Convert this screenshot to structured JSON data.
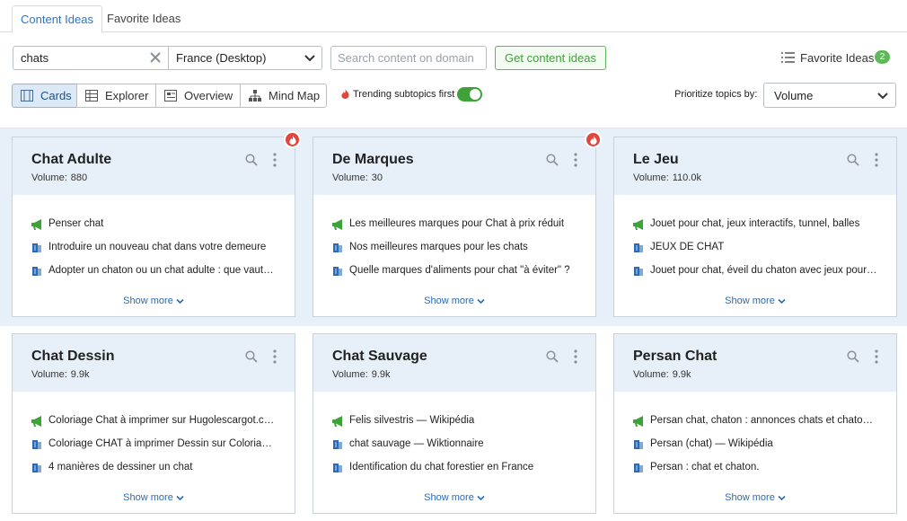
{
  "tabs": [
    {
      "label": "Content Ideas",
      "active": true
    },
    {
      "label": "Favorite Ideas",
      "active": false
    }
  ],
  "search": {
    "value": "chats"
  },
  "region": {
    "value": "France (Desktop)"
  },
  "domain_search": {
    "placeholder": "Search content on domain"
  },
  "get_button": {
    "label": "Get content ideas"
  },
  "favorite_ideas": {
    "label": "Favorite Ideas",
    "count": "2"
  },
  "views": [
    {
      "label": "Cards",
      "active": true,
      "icon": "cards-icon"
    },
    {
      "label": "Explorer",
      "active": false,
      "icon": "table-icon"
    },
    {
      "label": "Overview",
      "active": false,
      "icon": "overview-icon"
    },
    {
      "label": "Mind Map",
      "active": false,
      "icon": "mindmap-icon"
    }
  ],
  "trending": {
    "label": "Trending subtopics first",
    "enabled": true
  },
  "prioritize": {
    "label": "Prioritize topics by:",
    "value": "Volume"
  },
  "volume_label": "Volume:",
  "show_more_label": "Show more",
  "colors": {
    "accent_blue": "#2a76c8",
    "green": "#3fa13a",
    "hot_red": "#e0463c",
    "card_header": "#e7f0f9"
  },
  "cards": [
    {
      "title": "Chat Adulte",
      "volume": "880",
      "trending": true,
      "items": [
        {
          "type": "headline",
          "text": "Penser chat"
        },
        {
          "type": "question",
          "text": "Introduire un nouveau chat dans votre demeure"
        },
        {
          "type": "question",
          "text": "Adopter un chaton ou un chat adulte : que vaut-il mieux choisir ?"
        }
      ]
    },
    {
      "title": "De Marques",
      "volume": "30",
      "trending": true,
      "items": [
        {
          "type": "headline",
          "text": "Les meilleures marques pour Chat à prix réduit"
        },
        {
          "type": "question",
          "text": "Nos meilleures marques pour les chats"
        },
        {
          "type": "question",
          "text": "Quelle marques d'aliments pour chat \"à éviter\" ?"
        }
      ]
    },
    {
      "title": "Le Jeu",
      "volume": "110.0k",
      "trending": false,
      "items": [
        {
          "type": "headline",
          "text": "Jouet pour chat, jeux interactifs, tunnel, balles"
        },
        {
          "type": "question",
          "text": "JEUX DE CHAT"
        },
        {
          "type": "question",
          "text": "Jouet pour chat, éveil du chaton avec jeux pour chats"
        }
      ]
    },
    {
      "title": "Chat Dessin",
      "volume": "9.9k",
      "trending": false,
      "items": [
        {
          "type": "headline",
          "text": "Coloriage Chat à imprimer sur Hugolescargot.com"
        },
        {
          "type": "question",
          "text": "Coloriage CHAT à imprimer Dessin sur Coloriage.info"
        },
        {
          "type": "question",
          "text": "4 manières de dessiner un chat"
        }
      ]
    },
    {
      "title": "Chat Sauvage",
      "volume": "9.9k",
      "trending": false,
      "items": [
        {
          "type": "headline",
          "text": "Felis silvestris — Wikipédia"
        },
        {
          "type": "question",
          "text": "chat sauvage — Wiktionnaire"
        },
        {
          "type": "question",
          "text": "Identification du chat forestier en France"
        }
      ]
    },
    {
      "title": "Persan Chat",
      "volume": "9.9k",
      "trending": false,
      "items": [
        {
          "type": "headline",
          "text": "Persan chat, chaton : annonces chats et chatons persans"
        },
        {
          "type": "question",
          "text": "Persan (chat) — Wikipédia"
        },
        {
          "type": "question",
          "text": "Persan : chat et chaton."
        }
      ]
    }
  ]
}
